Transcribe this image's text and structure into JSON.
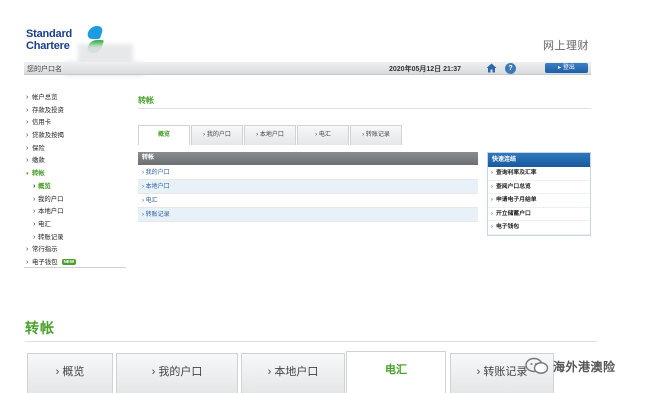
{
  "brand": {
    "logo_line1": "Standard",
    "logo_line2": "Chartere",
    "site_title": "网上理财"
  },
  "topbar": {
    "account_label": "您的户口名",
    "datetime": "2020年05月12日 21:37",
    "logout_label": "登出",
    "help_label": "?"
  },
  "sidebar": {
    "items": [
      {
        "label": "帐户总览"
      },
      {
        "label": "存款及投资"
      },
      {
        "label": "信用卡"
      },
      {
        "label": "贷款及按揭"
      },
      {
        "label": "保险"
      },
      {
        "label": "缴款"
      },
      {
        "label": "转帐"
      },
      {
        "label": "概览"
      },
      {
        "label": "我的户口"
      },
      {
        "label": "本地户口"
      },
      {
        "label": "电汇"
      },
      {
        "label": "转账记录"
      },
      {
        "label": "常行指示"
      },
      {
        "label": "电子钱包"
      }
    ],
    "new_badge": "NEW"
  },
  "main": {
    "title": "转帐",
    "tabs": [
      {
        "label": "概览"
      },
      {
        "label": "› 我的户口"
      },
      {
        "label": "› 本地户口"
      },
      {
        "label": "› 电汇"
      },
      {
        "label": "› 转账记录"
      }
    ],
    "panel_title": "转帐",
    "panel_rows": [
      {
        "label": "› 我的户口"
      },
      {
        "label": "› 本地户口"
      },
      {
        "label": "› 电汇"
      },
      {
        "label": "› 转账记录"
      }
    ]
  },
  "quick_links": {
    "title": "快速连结",
    "items": [
      {
        "label": "查询利率及汇率"
      },
      {
        "label": "查阅户口总览"
      },
      {
        "label": "申请电子月结单"
      },
      {
        "label": "开立储蓄户口"
      },
      {
        "label": "电子钱包"
      }
    ]
  },
  "zoom": {
    "title": "转帐",
    "tabs": [
      {
        "label": "› 概览"
      },
      {
        "label": "› 我的户口"
      },
      {
        "label": "› 本地户口"
      },
      {
        "label": "电汇"
      },
      {
        "label": "› 转账记录"
      }
    ]
  },
  "watermark": {
    "text": "海外港澳险"
  },
  "colors": {
    "accent_green": "#4aa02c",
    "link_blue": "#2a5d9f",
    "header_blue": "#1d5fa6"
  }
}
